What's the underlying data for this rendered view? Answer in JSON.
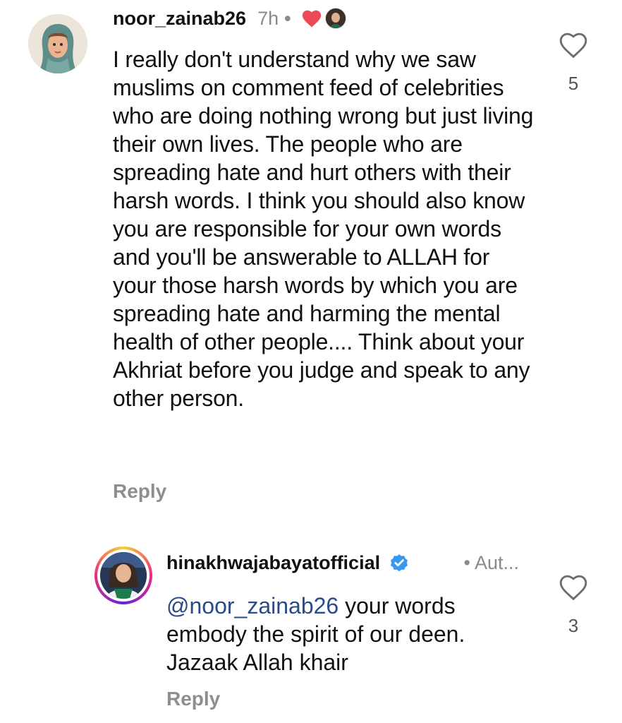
{
  "comments": [
    {
      "username": "noor_zainab26",
      "time": "7h",
      "separator": "•",
      "liked_by_author": true,
      "text": "I really don't understand why we saw muslims on comment feed of celebrities who are doing nothing wrong but just living their own lives. The people who are spreading hate and hurt others with their harsh words. I think you should also know you are responsible for your own words and you'll be answerable to ALLAH for your those harsh words by which you are spreading hate and harming the mental health of other people.... Think about your Akhriat before you judge and speak to any other person.",
      "reply_label": "Reply",
      "like_count": "5",
      "avatar_icon": "avatar-hijab-illustration"
    },
    {
      "username": "hinakhwajabayatofficial",
      "verified": true,
      "author_tag": "• Aut...",
      "mention": "@noor_zainab26",
      "text": " your words embody the spirit of our deen. Jazaak Allah khair",
      "reply_label": "Reply",
      "like_count": "3",
      "avatar_icon": "avatar-photo"
    }
  ],
  "colors": {
    "heart_red": "#ed4956",
    "verified_blue": "#3897f0",
    "muted_text": "#8e8e8e",
    "mention": "#2a4a8a"
  }
}
